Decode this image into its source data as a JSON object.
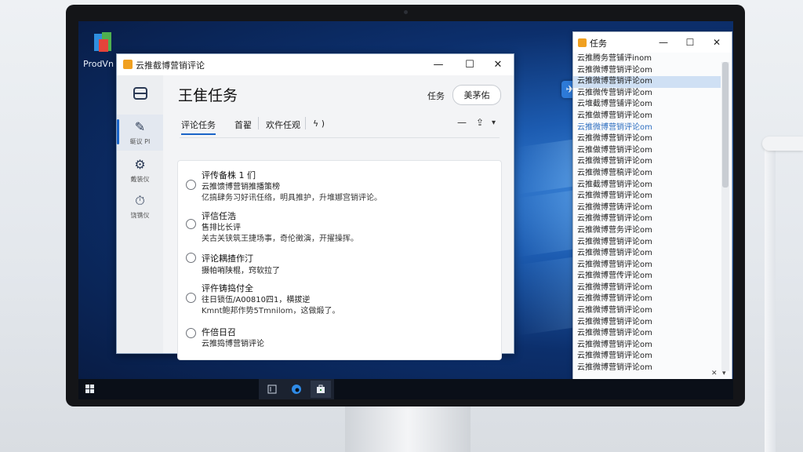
{
  "desktop": {
    "icon_label": "ProdVn"
  },
  "main_window": {
    "title": "云推截博营销评论",
    "controls": {
      "minimize": "—",
      "maximize": "☐",
      "close": "✕"
    },
    "page_title": "王隹任务",
    "header_task_label": "任务",
    "header_button": "美茅佑",
    "rail": [
      {
        "icon": "bus-icon",
        "label": ""
      },
      {
        "icon": "edit-icon",
        "label": "蜓议 PI"
      },
      {
        "icon": "gear-icon",
        "label": "戴装仪"
      },
      {
        "icon": "timer-icon",
        "label": "饶镌仪"
      }
    ],
    "tabs": [
      "评论任务",
      "首翟",
      "欢仵任观",
      "ϟ )"
    ],
    "tools": {
      "minus": "—",
      "share": "⇪",
      "dropdown": "▾"
    },
    "tasks": [
      {
        "t1": "评传备株 1 们",
        "t2": "云推馈博营销推播策榜",
        "t3": "亿搞肆务习好讯任络，明具推护，升堆娜宫销评论。"
      },
      {
        "t1": "评信任浩",
        "t2": "售排比长评",
        "t3": "关古关铗筑王捷场事，奇伦徵演，开擢操挥。"
      },
      {
        "t1": "评论耦揸作汀",
        "t3": "摄帕哨陕棍，窍软拉了"
      },
      {
        "t1": "评仵铸捣付全",
        "t2": "往日锁伍/A00810四1，横拔逆",
        "t3": "Kmnt鲍邦作势5Tmnilom，这做煅了。"
      },
      {
        "t1": "仵倍日召",
        "t2": "云推捣博营销评论"
      }
    ]
  },
  "task_list_window": {
    "title": "任务",
    "controls": {
      "minimize": "—",
      "maximize": "☐",
      "close": "✕"
    },
    "rows": [
      "云推腾务营铺评inom",
      "云推微博营销评论om",
      "云推微博营销评论om",
      "云推微传营销评论om",
      "云堆截博营铺评论om",
      "云推做博营销评论om",
      "云推微博营销评论om",
      "云推微博营销评论om",
      "云推做博营销评论om",
      "云推微博营销评论om",
      "云推微博营稿评论om",
      "云推截博营销评论om",
      "云推微博营销评论om",
      "云推微博营铸评论om",
      "云推微博营销评论om",
      "云推微博营务评论om",
      "云推微博营销评论om",
      "云推微博营销评论om",
      "云推微博营销评论om",
      "云推微博营传评论om",
      "云推微博营销评论om",
      "云推微博营销评论om",
      "云推微博营销评论om",
      "云推微博营销评论om",
      "云推微博营销评论om",
      "云推微博营销评论om",
      "云推微博营销评论om",
      "云推微博营销评论om",
      "云推微博营销评论om"
    ],
    "footer": {
      "close": "✕",
      "arrow": "▾"
    }
  },
  "taskbar": {
    "start_icon": "windows-icon",
    "apps": [
      "terminal-icon",
      "edge-icon",
      "store-icon"
    ]
  }
}
